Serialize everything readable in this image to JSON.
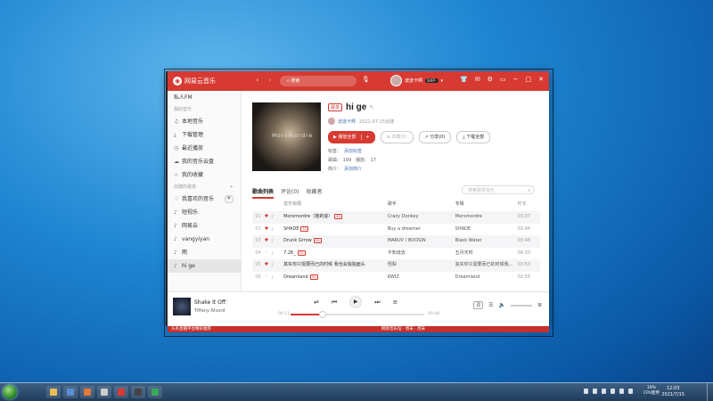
{
  "app": {
    "name": "网易云音乐",
    "search_placeholder": "搜索",
    "user_name": "波波卡啊",
    "vip_label": "SVIP ·"
  },
  "sidebar": {
    "items": [
      {
        "label": "私人FM",
        "icon": ""
      },
      {
        "header": "我的音乐"
      },
      {
        "label": "本地音乐",
        "icon": "music-note-icon"
      },
      {
        "label": "下载管理",
        "icon": "download-icon"
      },
      {
        "label": "最近播放",
        "icon": "clock-icon"
      },
      {
        "label": "我的音乐云盘",
        "icon": "cloud-icon"
      },
      {
        "label": "我的收藏",
        "icon": "star-icon"
      },
      {
        "header": "创建的歌单"
      },
      {
        "label": "我喜欢的音乐",
        "icon": "heart-icon"
      },
      {
        "label": "短视乐",
        "icon": "playlist-icon"
      },
      {
        "label": "网易云",
        "icon": "playlist-icon"
      },
      {
        "label": "vangyiyan",
        "icon": "playlist-icon"
      },
      {
        "label": "雨",
        "icon": "playlist-icon"
      },
      {
        "label": "hi ge",
        "icon": "playlist-icon",
        "active": true
      }
    ]
  },
  "playlist": {
    "tag": "歌单",
    "title": "hi ge",
    "cover_text": "Morsmordre",
    "creator": "波波卡啊",
    "created": "2021-07-15创建",
    "play_all": "播放全部",
    "plus": "+",
    "collect": "收藏(0)",
    "share": "分享(0)",
    "download_all": "下载全部",
    "tags_label": "标签：",
    "tags_link": "添加标签",
    "songs_label": "歌曲：",
    "songs_count": "199",
    "plays_label": "播放：",
    "plays_count": "17",
    "intro_label": "简介：",
    "intro_link": "添加简介"
  },
  "tabs": [
    "歌曲列表",
    "评论(0)",
    "收藏者"
  ],
  "list_search_placeholder": "搜索歌单音乐",
  "table": {
    "headers": [
      "音乐标题",
      "歌手",
      "专辑",
      "时长"
    ],
    "rows": [
      {
        "idx": "01",
        "liked": true,
        "title": "Morsmordre（施莉姿）",
        "sq": "SQ",
        "artist": "Crazy Donkey",
        "album": "Morsmordre",
        "dur": "03:37"
      },
      {
        "idx": "02",
        "liked": true,
        "title": "SHADE",
        "sq": "SQ",
        "artist": "Buy a dreamer",
        "album": "SHADE",
        "dur": "02:44"
      },
      {
        "idx": "03",
        "liked": true,
        "title": "Drunk Grrow",
        "sq": "SQ",
        "artist": "MARUV / BOOSIN",
        "album": "Black Water",
        "dur": "03:48"
      },
      {
        "idx": "04",
        "liked": false,
        "title": "7.26_",
        "sq": "SQ",
        "artist": "不知道去",
        "album": "五月天时",
        "dur": "04:33"
      },
      {
        "idx": "05",
        "liked": true,
        "title": "其实你只需要而已的时候 我也会独独面头",
        "sq": "",
        "artist": "怪梨",
        "album": "其实你只需要而已的时候我...",
        "dur": "03:53"
      },
      {
        "idx": "06",
        "liked": false,
        "title": "Dreamland",
        "sq": "SQ",
        "artist": "KWIZ",
        "album": "Dreamland",
        "dur": "02:55"
      }
    ]
  },
  "player": {
    "title": "Shake It Off",
    "artist": "Tiffany Alvord",
    "time_current": "00:11",
    "time_total": "00:48",
    "progress": 0.23,
    "lyric_label": "词"
  },
  "footer_bar": "头条直播平台精彩推荐",
  "footer_right": "网易音乐馆 · 周末 · 周末",
  "taskbar": {
    "cpu_percent": "19%",
    "cpu_label": "CPU使用",
    "time": "12:03",
    "date": "2021/7/15"
  }
}
